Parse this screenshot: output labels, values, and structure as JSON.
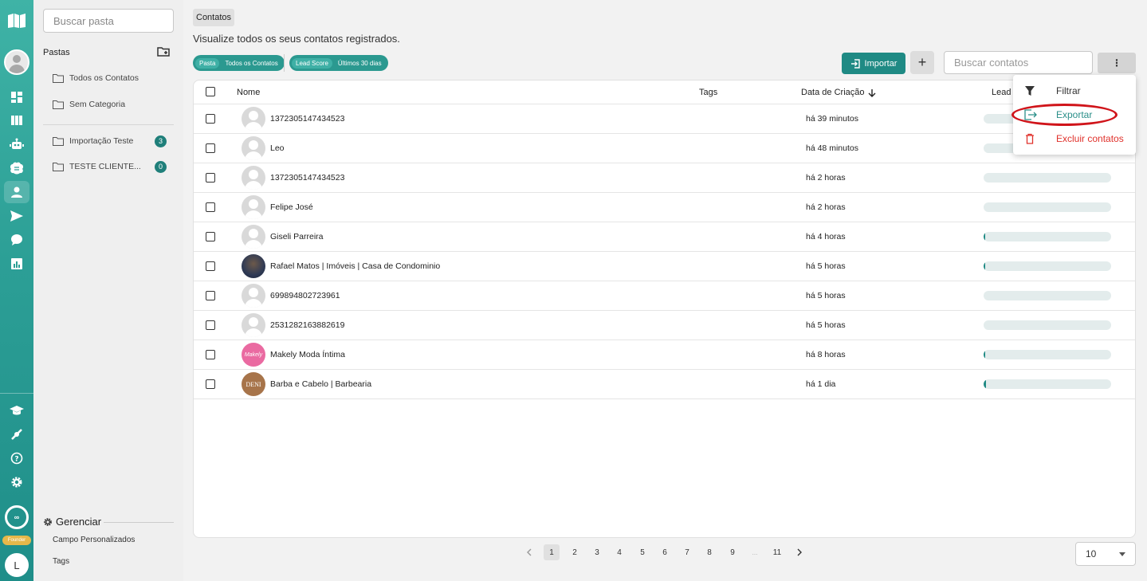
{
  "rail": {
    "avatar_letter": "L",
    "badge_symbol": "∞",
    "founder_label": "Founder"
  },
  "sidebar": {
    "search_placeholder": "Buscar pasta",
    "pastas_title": "Pastas",
    "folders": [
      {
        "label": "Todos os Contatos"
      },
      {
        "label": "Sem Categoria"
      },
      {
        "label": "Importação Teste",
        "count": "3"
      },
      {
        "label": "TESTE CLIENTE...",
        "count": "0"
      }
    ],
    "manage_title": "Gerenciar",
    "manage_links": [
      "Campo Personalizados",
      "Tags"
    ]
  },
  "header": {
    "breadcrumb": "Contatos",
    "subtitle": "Visualize todos os seus contatos registrados.",
    "filters": [
      {
        "label": "Pasta",
        "value": "Todos os Contatos"
      },
      {
        "label": "Lead Score",
        "value": "Últimos 30 dias"
      }
    ],
    "import_label": "Importar",
    "plus_label": "+",
    "search_placeholder": "Buscar contatos",
    "more_label": "⋮"
  },
  "table": {
    "columns": {
      "name": "Nome",
      "tags": "Tags",
      "created": "Data de Criação",
      "lead_score": "Lead S"
    },
    "sort_icon": "arrow-down-icon",
    "rows": [
      {
        "name": "1372305147434523",
        "created": "há 39 minutos",
        "avatar": "default",
        "score": 0
      },
      {
        "name": "Leo",
        "created": "há 48 minutos",
        "avatar": "default",
        "score": 0
      },
      {
        "name": "1372305147434523",
        "created": "há 2 horas",
        "avatar": "default",
        "score": 0
      },
      {
        "name": "Felipe José",
        "created": "há 2 horas",
        "avatar": "default",
        "score": 0
      },
      {
        "name": "Giseli Parreira",
        "created": "há 4 horas",
        "avatar": "default",
        "score": 0.01
      },
      {
        "name": "Rafael Matos | Imóveis | Casa de Condominio",
        "created": "há 5 horas",
        "avatar": "person",
        "score": 0.01
      },
      {
        "name": "699894802723961",
        "created": "há 5 horas",
        "avatar": "default",
        "score": 0
      },
      {
        "name": "2531282163882619",
        "created": "há 5 horas",
        "avatar": "default",
        "score": 0
      },
      {
        "name": "Makely Moda Íntima",
        "created": "há 8 horas",
        "avatar": "pink",
        "avatar_text": "Makely",
        "score": 0.01
      },
      {
        "name": "Barba e Cabelo | Barbearia",
        "created": "há 1 dia",
        "avatar": "brown",
        "avatar_text": "DENI",
        "score": 0.02
      }
    ]
  },
  "menu": {
    "items": [
      {
        "label": "Filtrar",
        "icon": "filter-icon",
        "color": "#333333"
      },
      {
        "label": "Exportar",
        "icon": "export-icon",
        "color": "#2b8f89"
      },
      {
        "label": "Excluir contatos",
        "icon": "trash-icon",
        "color": "#e0312b"
      }
    ]
  },
  "pagination": {
    "pages": [
      "1",
      "2",
      "3",
      "4",
      "5",
      "6",
      "7",
      "8",
      "9",
      "...",
      "11"
    ],
    "current": "1",
    "page_size": "10"
  },
  "colors": {
    "accent": "#1f8a84",
    "danger": "#e0312b",
    "highlight": "#d0141a"
  }
}
